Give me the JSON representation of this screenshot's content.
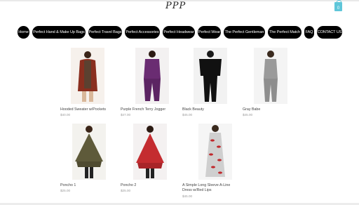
{
  "header": {
    "logo": "PPP",
    "cart_count": "0"
  },
  "nav": {
    "items": [
      "Home",
      "Perfect Hand & Make Up Bags",
      "Perfect Travel Bags",
      "Perfect Accessories",
      "Perfect Headwear",
      "Perfect Wear",
      "The Perfect Gentleman",
      "The Perfect Match",
      "FAQ",
      "CONTACT US"
    ]
  },
  "products": [
    {
      "name": "Hooded Sweater w/Pockets",
      "price": "$40.00",
      "color": "#8a2f1f"
    },
    {
      "name": "Purple French Terry Jogger",
      "price": "$47.00",
      "color": "#6a2c72"
    },
    {
      "name": "Black Beauty",
      "price": "$45.00",
      "color": "#111111"
    },
    {
      "name": "Gray Babe",
      "price": "$45.00",
      "color": "#9a9a9a"
    },
    {
      "name": "Poncho 1",
      "price": "$25.00",
      "color": "#5e5a3a"
    },
    {
      "name": "Poncho 2",
      "price": "$25.00",
      "color": "#c42c30"
    },
    {
      "name": "A Simple Long Sleeve A-Line Dress w/Red Lips",
      "price": "$45.00",
      "color": "#cfcfcf"
    }
  ]
}
